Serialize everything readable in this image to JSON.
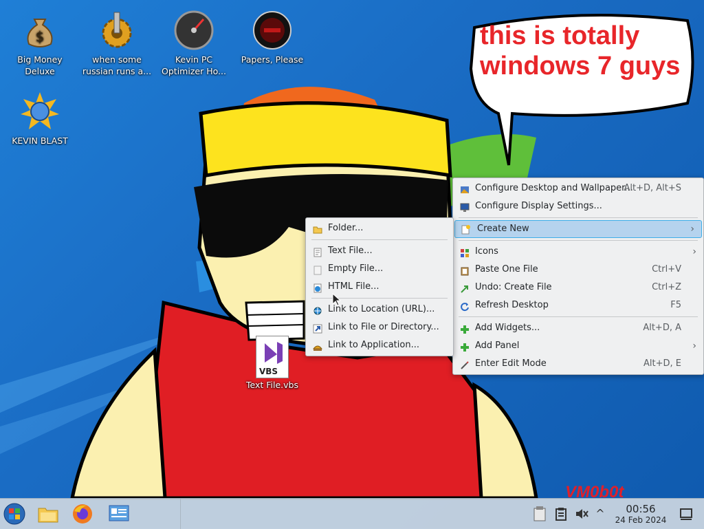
{
  "desktop": {
    "icons": [
      {
        "label": "Big Money Deluxe"
      },
      {
        "label": "when some russian runs a..."
      },
      {
        "label": "Kevin PC Optimizer Ho..."
      },
      {
        "label": "Papers, Please"
      },
      {
        "label": "KEVIN BLAST"
      }
    ],
    "file": {
      "label": "Text File.vbs",
      "badge": "VBS"
    }
  },
  "meme": {
    "bubble_line1": "this is totally",
    "bubble_line2": "windows 7 guys",
    "signature": "VM0b0t"
  },
  "context_menu": {
    "items": [
      {
        "label": "Configure Desktop and Wallpaper...",
        "shortcut": "Alt+D, Alt+S"
      },
      {
        "label": "Configure Display Settings...",
        "shortcut": ""
      },
      {
        "label": "Create New",
        "shortcut": ""
      },
      {
        "label": "Icons",
        "shortcut": ""
      },
      {
        "label": "Paste One File",
        "shortcut": "Ctrl+V"
      },
      {
        "label": "Undo: Create File",
        "shortcut": "Ctrl+Z"
      },
      {
        "label": "Refresh Desktop",
        "shortcut": "F5"
      },
      {
        "label": "Add Widgets...",
        "shortcut": "Alt+D, A"
      },
      {
        "label": "Add Panel",
        "shortcut": ""
      },
      {
        "label": "Enter Edit Mode",
        "shortcut": "Alt+D, E"
      }
    ],
    "submenu_arrow": "›"
  },
  "create_new_menu": {
    "items": [
      {
        "label": "Folder..."
      },
      {
        "label": "Text File..."
      },
      {
        "label": "Empty File..."
      },
      {
        "label": "HTML File..."
      },
      {
        "label": "Link to Location (URL)..."
      },
      {
        "label": "Link to File or Directory..."
      },
      {
        "label": "Link to Application..."
      }
    ]
  },
  "taskbar": {
    "tray_arrow": "^",
    "clock_time": "00:56",
    "clock_date": "24 Feb 2024"
  },
  "colors": {
    "accent": "#3daee9",
    "highlight": "#b5d3ee",
    "meme_text": "#e8262a"
  }
}
